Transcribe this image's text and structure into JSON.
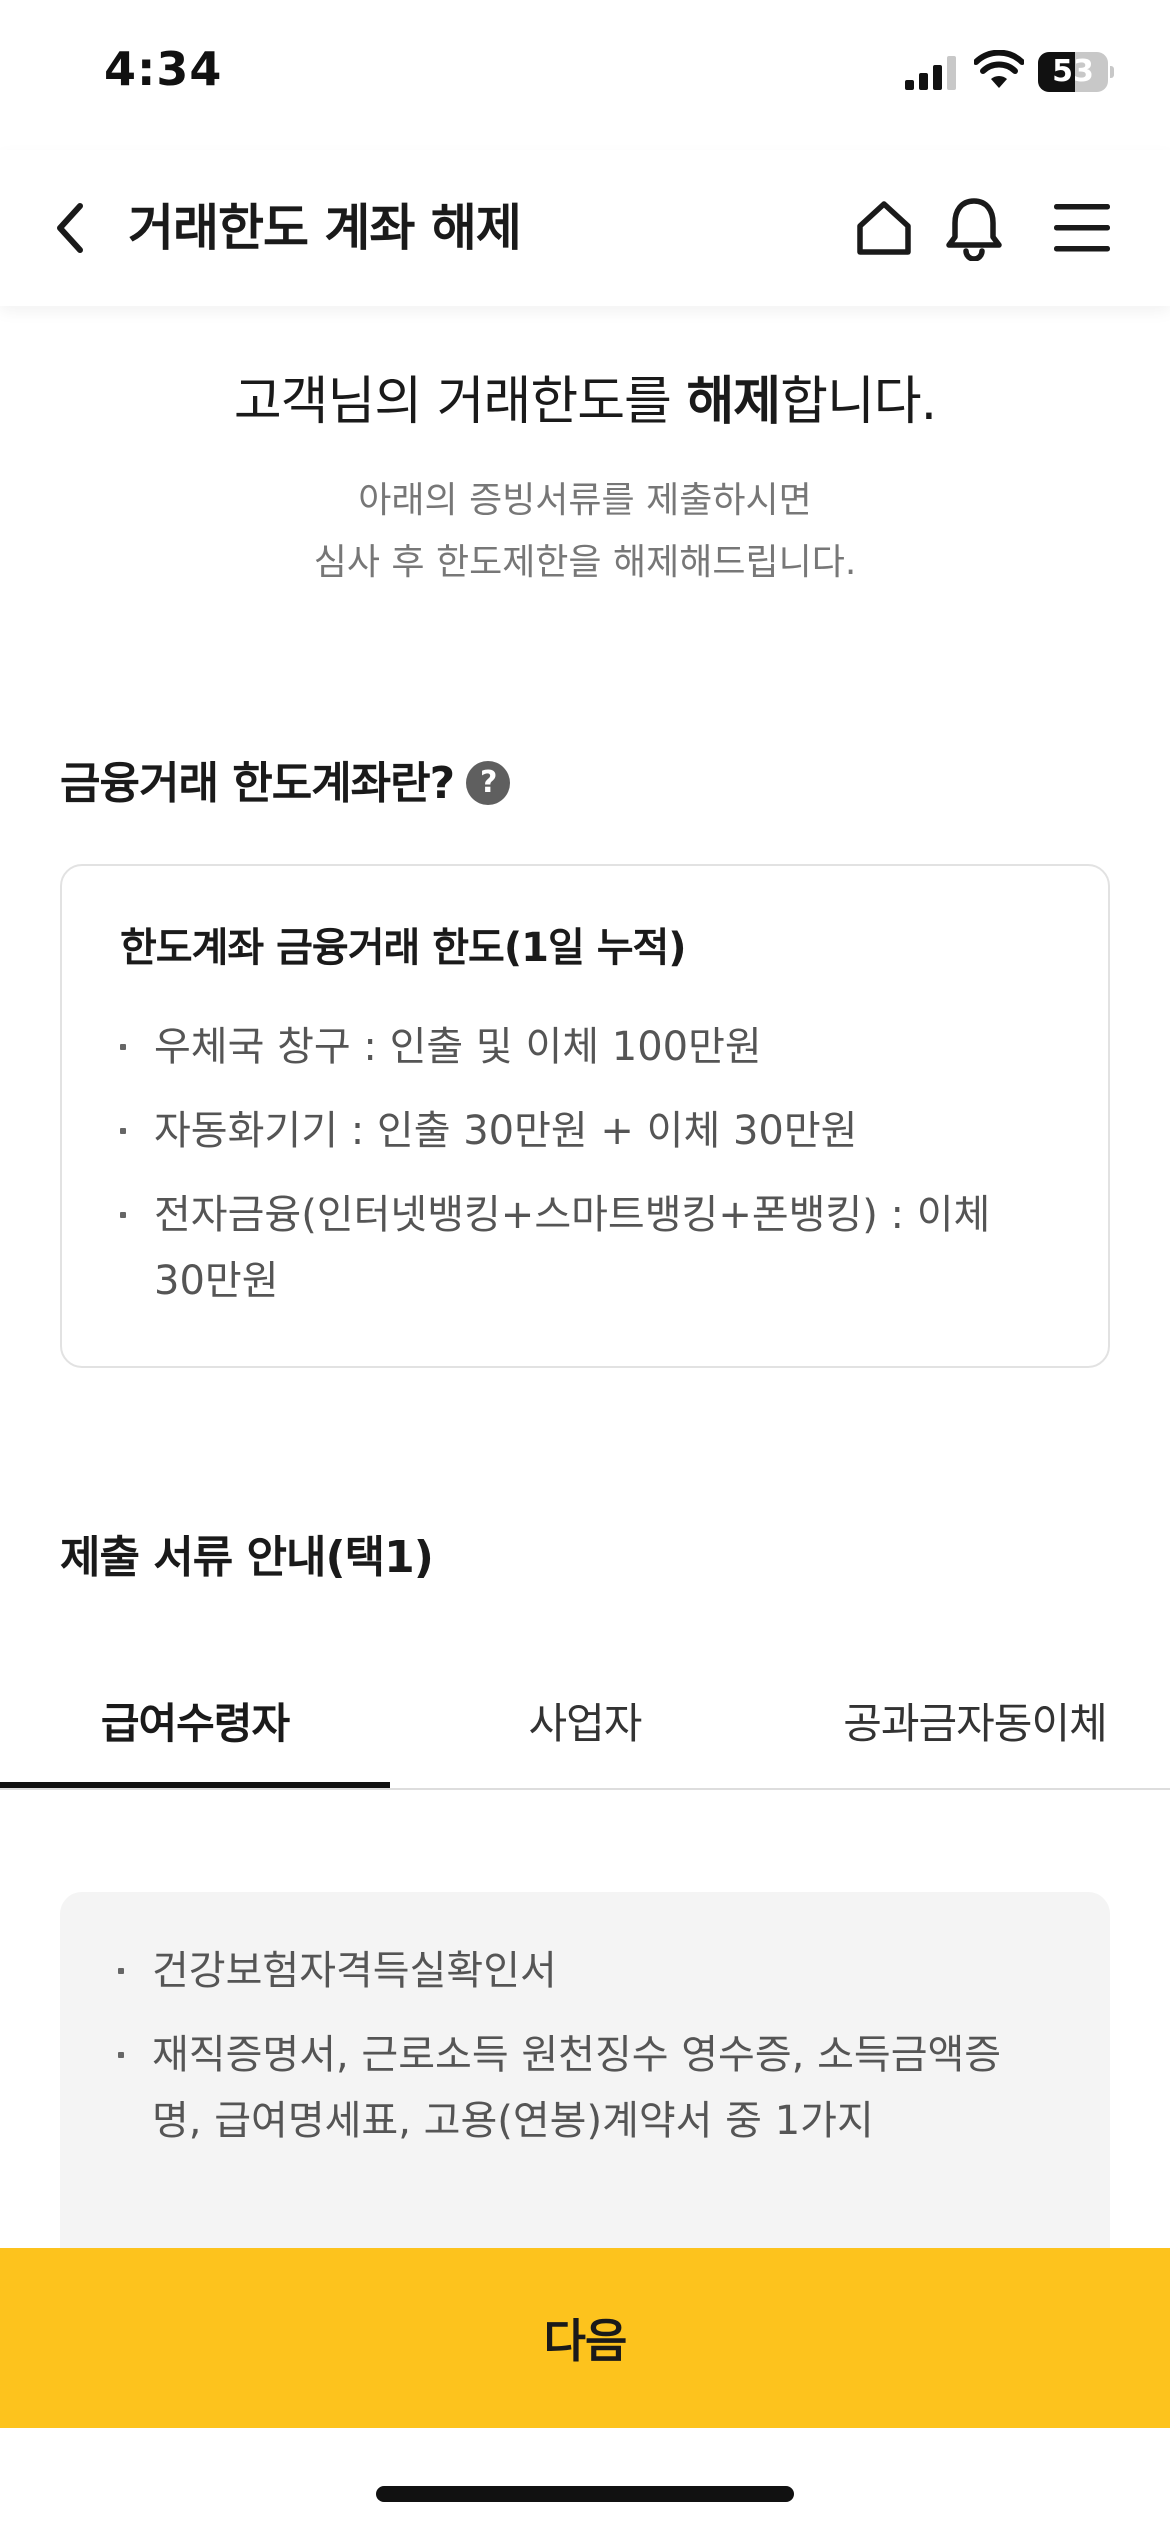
{
  "status_bar": {
    "time": "4:34",
    "battery_level": "53",
    "battery_fraction": 0.53
  },
  "header": {
    "title": "거래한도 계좌 해제",
    "icons": [
      "chevron-left-icon",
      "home-icon",
      "bell-icon",
      "menu-icon"
    ]
  },
  "intro": {
    "heading_before": "고객님의 거래한도를 ",
    "heading_emphasis": "해제",
    "heading_after": "합니다.",
    "desc_line1": "아래의 증빙서류를 제출하시면",
    "desc_line2": "심사 후 한도제한을 해제해드립니다."
  },
  "limit_section": {
    "title": "금융거래 한도계좌란?",
    "help_symbol": "?",
    "box_title": "한도계좌 금융거래 한도(1일 누적)",
    "items": [
      "우체국 창구 : 인출 및 이체 100만원",
      "자동화기기 : 인출 30만원 + 이체 30만원",
      "전자금융(인터넷뱅킹+스마트뱅킹+폰뱅킹) : 이체 30만원"
    ]
  },
  "docs_section": {
    "title": "제출 서류 안내(택1)",
    "tabs": [
      {
        "label": "급여수령자",
        "active": true
      },
      {
        "label": "사업자",
        "active": false
      },
      {
        "label": "공과금자동이체",
        "active": false
      }
    ],
    "items": [
      "건강보험자격득실확인서",
      "재직증명서, 근로소득 원천징수 영수증, 소득금액증명, 급여명세표, 고용(연봉)계약서 중 1가지"
    ]
  },
  "footer": {
    "next_label": "다음"
  },
  "colors": {
    "accent": "#fdc31d",
    "text_primary": "#1a1a1a",
    "text_secondary": "#555555",
    "box_border": "#e2e2e2",
    "docs_box_bg": "#f4f4f4"
  }
}
